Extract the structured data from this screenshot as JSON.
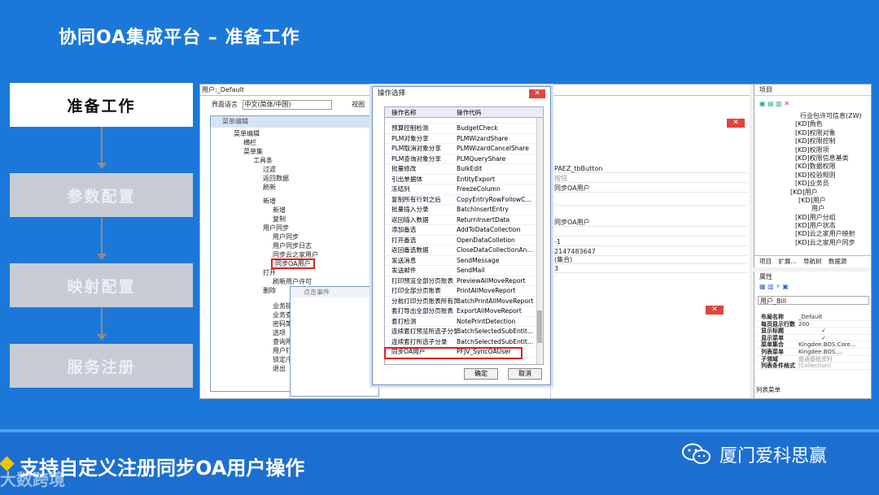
{
  "slide": {
    "title": "协同OA集成平台 – 准备工作",
    "steps": [
      "准备工作",
      "参数配置",
      "映射配置",
      "服务注册"
    ],
    "caption": "支持自定义注册同步OA用户操作",
    "brand": "厦门爱科思赢",
    "watermark": "大数跨境",
    "colors": {
      "background": "#1c78d8",
      "active_step": "#ffffff",
      "inactive_step": "#c8cbd4",
      "highlight": "#e02020"
    }
  },
  "app": {
    "tab_title": "用户:_Default",
    "lang_label": "界面语言",
    "lang_value": "中文(简体/中国)",
    "view_label": "视图",
    "menu_window": {
      "title": "菜单编辑",
      "tree": [
        "菜单编辑",
        "横栏",
        "菜单集",
        "工具条",
        "过滤",
        "返回数据",
        "刷新",
        "新增",
        "新增",
        "复制",
        "用户同步",
        "用户同步",
        "用户同步日志",
        "同步云之家用户",
        "同步OA用户",
        "打开",
        "刷新用户许可",
        "删除",
        "业务操作",
        "业务查询",
        "密码策略",
        "选项",
        "查询用户",
        "用户打印",
        "锁定/锁",
        "退出"
      ]
    },
    "event_window": {
      "title": "点击事件"
    },
    "form": {
      "rows": [
        "PAEZ_tbButton",
        "按钮",
        "同步OA用户",
        "",
        "同步OA用户",
        "",
        "-1",
        "2147483647",
        "(集合)",
        "3"
      ]
    },
    "project_panel": {
      "title": "项目",
      "tree": [
        "行业包许可信息(ZW)",
        "[KD]角色",
        "[KD]权限对象",
        "[KD]权限控制",
        "[KD]权限项",
        "[KD]权限信息基类",
        "[KD]数据权限",
        "[KD]校验规则",
        "[KD]业务员",
        "[KD]用户",
        "[KD]用户",
        "用户",
        "[KD]用户分组",
        "[KD]用户状态",
        "[KD]云之家用户映射",
        "[KD]云之家用户同步"
      ],
      "tabs": [
        "项目",
        "扩展...",
        "导航树",
        "数据源"
      ]
    },
    "properties_panel": {
      "title": "属性",
      "object": "用户_Bill",
      "rows": [
        {
          "k": "布局名称",
          "v": "_Default"
        },
        {
          "k": "每页显示行数",
          "v": "200"
        },
        {
          "k": "显示标题",
          "v": "✓"
        },
        {
          "k": "显示菜单",
          "v": "✓"
        },
        {
          "k": "菜单集合",
          "v": "Kingdee.BOS.Core..."
        },
        {
          "k": "列表菜单",
          "v": "Kingdee.BOS...."
        },
        {
          "k": "子领域",
          "v": "普通基础资料"
        },
        {
          "k": "列表条件格式",
          "v": "(Collection)"
        }
      ],
      "bottom_tab": "列表菜单"
    }
  },
  "dialog": {
    "title": "操作选择",
    "col_name": "操作名称",
    "col_code": "操作代码",
    "rows": [
      {
        "name": "预算控制检测",
        "code": "BudgetCheck"
      },
      {
        "name": "PLM对象分享",
        "code": "PLMWizardShare"
      },
      {
        "name": "PLM取消对象分享",
        "code": "PLMWizardCancelShare"
      },
      {
        "name": "PLM查询对象分享",
        "code": "PLMQueryShare"
      },
      {
        "name": "批量修改",
        "code": "BulkEdit"
      },
      {
        "name": "引出单据体",
        "code": "EntityExport"
      },
      {
        "name": "冻结列",
        "code": "FreezeColumn"
      },
      {
        "name": "复制所有行到之后",
        "code": "CopyEntryRowFollowC..."
      },
      {
        "name": "批量插入分录",
        "code": "BatchInsertEntry"
      },
      {
        "name": "返回插入数据",
        "code": "ReturnInsertData"
      },
      {
        "name": "添加备选",
        "code": "AddToDataCollection"
      },
      {
        "name": "打开备选",
        "code": "OpenDataColletion"
      },
      {
        "name": "返回备选数据",
        "code": "CloseDataCollectionAn..."
      },
      {
        "name": "发送消息",
        "code": "SendMessage"
      },
      {
        "name": "发送邮件",
        "code": "SendMail"
      },
      {
        "name": "打印预览全部分页账表",
        "code": "PreviewAllMoveReport"
      },
      {
        "name": "打印全部分页账表",
        "code": "PrintAllMoveReport"
      },
      {
        "name": "分批打印分页账表所有页",
        "code": "BatchPrintAllMoveReport"
      },
      {
        "name": "套打导出全部分页账表",
        "code": "ExportAllMoveReport"
      },
      {
        "name": "套打检测",
        "code": "NotePrintDetection"
      },
      {
        "name": "连续套打预览所选子分录",
        "code": "BatchSelectedSubEntit..."
      },
      {
        "name": "连续套打所选子分录",
        "code": "BatchSelectedSubEntit..."
      },
      {
        "name": "同步OA用户",
        "code": "PFJV_SyncOAUser"
      }
    ],
    "ok": "确定",
    "cancel": "取消"
  }
}
